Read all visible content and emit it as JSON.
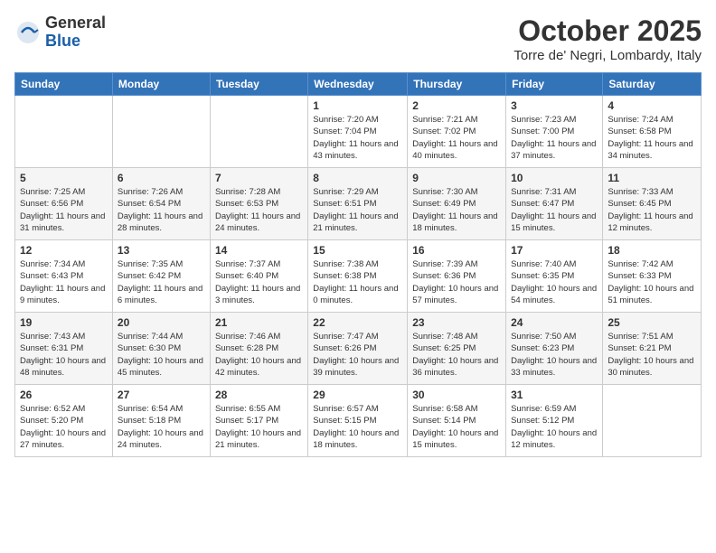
{
  "logo": {
    "general": "General",
    "blue": "Blue"
  },
  "header": {
    "title": "October 2025",
    "location": "Torre de' Negri, Lombardy, Italy"
  },
  "weekdays": [
    "Sunday",
    "Monday",
    "Tuesday",
    "Wednesday",
    "Thursday",
    "Friday",
    "Saturday"
  ],
  "weeks": [
    [
      {
        "day": "",
        "info": ""
      },
      {
        "day": "",
        "info": ""
      },
      {
        "day": "",
        "info": ""
      },
      {
        "day": "1",
        "info": "Sunrise: 7:20 AM\nSunset: 7:04 PM\nDaylight: 11 hours and 43 minutes."
      },
      {
        "day": "2",
        "info": "Sunrise: 7:21 AM\nSunset: 7:02 PM\nDaylight: 11 hours and 40 minutes."
      },
      {
        "day": "3",
        "info": "Sunrise: 7:23 AM\nSunset: 7:00 PM\nDaylight: 11 hours and 37 minutes."
      },
      {
        "day": "4",
        "info": "Sunrise: 7:24 AM\nSunset: 6:58 PM\nDaylight: 11 hours and 34 minutes."
      }
    ],
    [
      {
        "day": "5",
        "info": "Sunrise: 7:25 AM\nSunset: 6:56 PM\nDaylight: 11 hours and 31 minutes."
      },
      {
        "day": "6",
        "info": "Sunrise: 7:26 AM\nSunset: 6:54 PM\nDaylight: 11 hours and 28 minutes."
      },
      {
        "day": "7",
        "info": "Sunrise: 7:28 AM\nSunset: 6:53 PM\nDaylight: 11 hours and 24 minutes."
      },
      {
        "day": "8",
        "info": "Sunrise: 7:29 AM\nSunset: 6:51 PM\nDaylight: 11 hours and 21 minutes."
      },
      {
        "day": "9",
        "info": "Sunrise: 7:30 AM\nSunset: 6:49 PM\nDaylight: 11 hours and 18 minutes."
      },
      {
        "day": "10",
        "info": "Sunrise: 7:31 AM\nSunset: 6:47 PM\nDaylight: 11 hours and 15 minutes."
      },
      {
        "day": "11",
        "info": "Sunrise: 7:33 AM\nSunset: 6:45 PM\nDaylight: 11 hours and 12 minutes."
      }
    ],
    [
      {
        "day": "12",
        "info": "Sunrise: 7:34 AM\nSunset: 6:43 PM\nDaylight: 11 hours and 9 minutes."
      },
      {
        "day": "13",
        "info": "Sunrise: 7:35 AM\nSunset: 6:42 PM\nDaylight: 11 hours and 6 minutes."
      },
      {
        "day": "14",
        "info": "Sunrise: 7:37 AM\nSunset: 6:40 PM\nDaylight: 11 hours and 3 minutes."
      },
      {
        "day": "15",
        "info": "Sunrise: 7:38 AM\nSunset: 6:38 PM\nDaylight: 11 hours and 0 minutes."
      },
      {
        "day": "16",
        "info": "Sunrise: 7:39 AM\nSunset: 6:36 PM\nDaylight: 10 hours and 57 minutes."
      },
      {
        "day": "17",
        "info": "Sunrise: 7:40 AM\nSunset: 6:35 PM\nDaylight: 10 hours and 54 minutes."
      },
      {
        "day": "18",
        "info": "Sunrise: 7:42 AM\nSunset: 6:33 PM\nDaylight: 10 hours and 51 minutes."
      }
    ],
    [
      {
        "day": "19",
        "info": "Sunrise: 7:43 AM\nSunset: 6:31 PM\nDaylight: 10 hours and 48 minutes."
      },
      {
        "day": "20",
        "info": "Sunrise: 7:44 AM\nSunset: 6:30 PM\nDaylight: 10 hours and 45 minutes."
      },
      {
        "day": "21",
        "info": "Sunrise: 7:46 AM\nSunset: 6:28 PM\nDaylight: 10 hours and 42 minutes."
      },
      {
        "day": "22",
        "info": "Sunrise: 7:47 AM\nSunset: 6:26 PM\nDaylight: 10 hours and 39 minutes."
      },
      {
        "day": "23",
        "info": "Sunrise: 7:48 AM\nSunset: 6:25 PM\nDaylight: 10 hours and 36 minutes."
      },
      {
        "day": "24",
        "info": "Sunrise: 7:50 AM\nSunset: 6:23 PM\nDaylight: 10 hours and 33 minutes."
      },
      {
        "day": "25",
        "info": "Sunrise: 7:51 AM\nSunset: 6:21 PM\nDaylight: 10 hours and 30 minutes."
      }
    ],
    [
      {
        "day": "26",
        "info": "Sunrise: 6:52 AM\nSunset: 5:20 PM\nDaylight: 10 hours and 27 minutes."
      },
      {
        "day": "27",
        "info": "Sunrise: 6:54 AM\nSunset: 5:18 PM\nDaylight: 10 hours and 24 minutes."
      },
      {
        "day": "28",
        "info": "Sunrise: 6:55 AM\nSunset: 5:17 PM\nDaylight: 10 hours and 21 minutes."
      },
      {
        "day": "29",
        "info": "Sunrise: 6:57 AM\nSunset: 5:15 PM\nDaylight: 10 hours and 18 minutes."
      },
      {
        "day": "30",
        "info": "Sunrise: 6:58 AM\nSunset: 5:14 PM\nDaylight: 10 hours and 15 minutes."
      },
      {
        "day": "31",
        "info": "Sunrise: 6:59 AM\nSunset: 5:12 PM\nDaylight: 10 hours and 12 minutes."
      },
      {
        "day": "",
        "info": ""
      }
    ]
  ]
}
